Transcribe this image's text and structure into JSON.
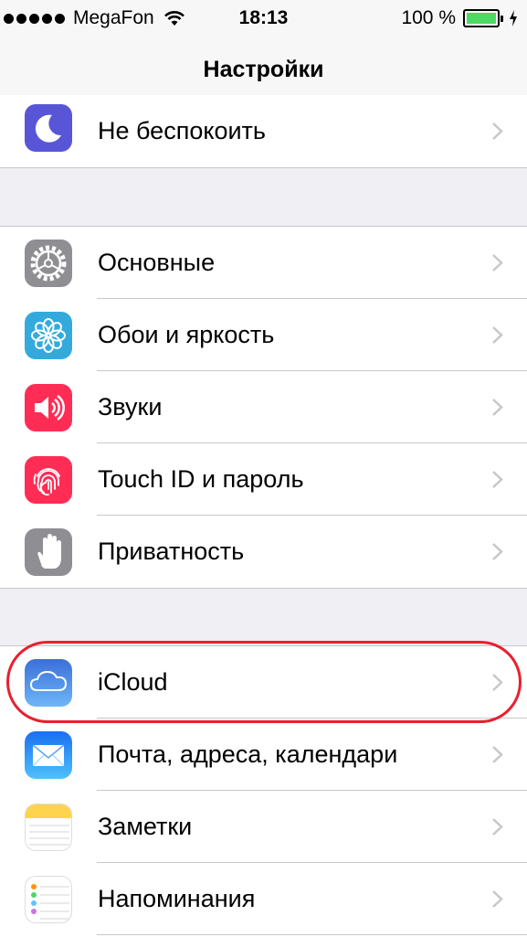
{
  "status_bar": {
    "carrier": "MegaFon",
    "time": "18:13",
    "battery_percent": "100 %",
    "battery_level": 1.0
  },
  "nav": {
    "title": "Настройки"
  },
  "groups": [
    {
      "rows": [
        {
          "label": "Не беспокоить",
          "icon": "moon-icon",
          "color": "#5856d6"
        }
      ]
    },
    {
      "rows": [
        {
          "label": "Основные",
          "icon": "gear-icon",
          "color": "#8e8e93"
        },
        {
          "label": "Обои и яркость",
          "icon": "flower-icon",
          "color": "#34aadc"
        },
        {
          "label": "Звуки",
          "icon": "speaker-icon",
          "color": "#ff2d55"
        },
        {
          "label": "Touch ID и пароль",
          "icon": "fingerprint-icon",
          "color": "#ff2d55"
        },
        {
          "label": "Приватность",
          "icon": "hand-icon",
          "color": "#8e8e93"
        }
      ]
    },
    {
      "rows": [
        {
          "label": "iCloud",
          "icon": "cloud-icon",
          "color": "#4a7fe0"
        },
        {
          "label": "Почта, адреса, календари",
          "icon": "mail-icon",
          "color": "#1d8cf8"
        },
        {
          "label": "Заметки",
          "icon": "notes-icon",
          "color": "#fedb5d"
        },
        {
          "label": "Напоминания",
          "icon": "reminders-icon",
          "color": "#ffffff"
        }
      ]
    }
  ],
  "highlight_color": "#e8202e"
}
